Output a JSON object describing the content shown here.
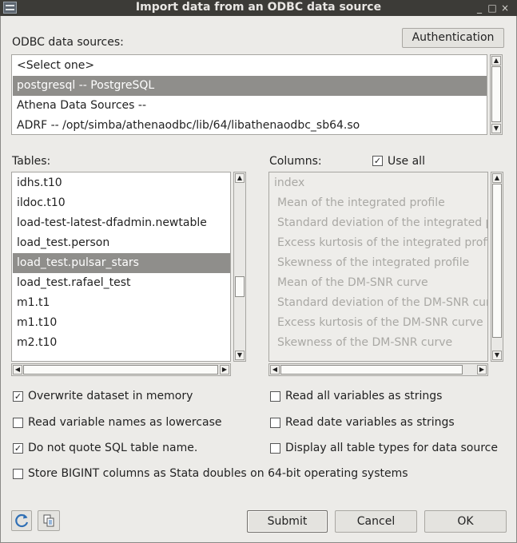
{
  "window": {
    "title": "Import data from an ODBC data source"
  },
  "sources": {
    "label": "ODBC data sources:",
    "items": [
      {
        "label": "<Select one>",
        "selected": false
      },
      {
        "label": "postgresql -- PostgreSQL",
        "selected": true
      },
      {
        "label": "Athena Data Sources --",
        "selected": false
      },
      {
        "label": "ADRF -- /opt/simba/athenaodbc/lib/64/libathenaodbc_sb64.so",
        "selected": false
      }
    ]
  },
  "auth_button": "Authentication",
  "tables": {
    "label": "Tables:",
    "items": [
      {
        "label": "idhs.t10",
        "selected": false
      },
      {
        "label": "ildoc.t10",
        "selected": false
      },
      {
        "label": "load-test-latest-dfadmin.newtable",
        "selected": false
      },
      {
        "label": "load_test.person",
        "selected": false
      },
      {
        "label": "load_test.pulsar_stars",
        "selected": true
      },
      {
        "label": "load_test.rafael_test",
        "selected": false
      },
      {
        "label": "m1.t1",
        "selected": false
      },
      {
        "label": "m1.t10",
        "selected": false
      },
      {
        "label": "m2.t10",
        "selected": false
      }
    ]
  },
  "columns": {
    "label": "Columns:",
    "use_all": {
      "label": "Use all",
      "checked": true
    },
    "items": [
      "index",
      "Mean of the integrated profile",
      "Standard deviation of the integrated prof",
      "Excess kurtosis of the integrated profile",
      "Skewness of the integrated profile",
      "Mean of the DM-SNR curve",
      "Standard deviation of the DM-SNR curve",
      "Excess kurtosis of the DM-SNR curve",
      "Skewness of the DM-SNR curve"
    ]
  },
  "options": {
    "overwrite": {
      "label": "Overwrite dataset in memory",
      "checked": true
    },
    "lowercase": {
      "label": "Read variable names as lowercase",
      "checked": false
    },
    "noquote": {
      "label": "Do not quote SQL table name.",
      "checked": true
    },
    "allstrings": {
      "label": "Read all variables as strings",
      "checked": false
    },
    "datestrings": {
      "label": "Read date variables as strings",
      "checked": false
    },
    "alltypes": {
      "label": "Display all table types for data source",
      "checked": false
    },
    "bigint": {
      "label": "Store BIGINT columns as Stata doubles on 64-bit operating systems",
      "checked": false
    }
  },
  "buttons": {
    "submit": "Submit",
    "cancel": "Cancel",
    "ok": "OK"
  },
  "icons": {
    "app": "dialog-icon",
    "refresh": "refresh-icon",
    "copy": "copy-icon",
    "check_glyph": "✓",
    "arrow_up": "▲",
    "arrow_down": "▼",
    "arrow_left": "◀",
    "arrow_right": "▶",
    "minimize": "_",
    "maximize": "□",
    "close": "×"
  },
  "colors": {
    "titlebar": "#3c3b37",
    "selection": "#8f8e8b",
    "accent_icon": "#2f6fb5"
  }
}
